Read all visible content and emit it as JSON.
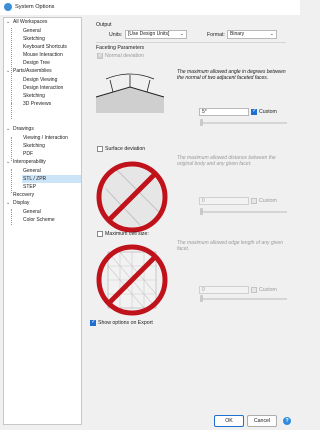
{
  "window": {
    "title": "System Options"
  },
  "tree": {
    "workspaces": "All Workspaces",
    "general": "General",
    "sketching": "Sketching",
    "keyboard": "Keyboard Shortcuts",
    "mouse": "Mouse Interaction",
    "design_tree": "Design Tree",
    "parts": "Parts/Assemblies",
    "design_viewing": "Design Viewing",
    "design_interaction": "Design Interaction",
    "parts_sketching": "Sketching",
    "previews": "3D Previews",
    "drawings": "Drawings",
    "viewing_interaction": "Viewing / Interaction",
    "drawings_sketching": "Sketching",
    "pdf": "PDF",
    "interop": "Interoperability",
    "interop_general": "General",
    "stl": "STL / ZPR",
    "step": "STEP",
    "recovery": "Recovery",
    "display": "Display",
    "display_general": "General",
    "color_scheme": "Color Scheme"
  },
  "output": {
    "section": "Output",
    "units_label": "Units:",
    "units_value": "[Use Design Units]",
    "format_label": "Format:",
    "format_value": "Binary"
  },
  "faceting": {
    "section": "Faceting Parameters",
    "normal_deviation": "Normal deviation",
    "normal_desc": "The maximum allowed angle in degrees between the normal of two adjacent faceted faces.",
    "normal_value": "5°",
    "custom": "Custom",
    "surface_deviation": "Surface deviation",
    "surface_desc": "The maximum allowed distance between the original body and any given facet.",
    "surface_value": "0",
    "max_cell": "Maximum cell size:",
    "cell_desc": "The maximum allowed edge length of any given facet.",
    "cell_value": "0"
  },
  "show_options": "Show options on Export",
  "buttons": {
    "ok": "OK",
    "cancel": "Cancel",
    "help": "?"
  },
  "colors": {
    "accent": "#1f6fd1",
    "no_symbol": "#c0121b",
    "selected": "#cce4f7"
  }
}
